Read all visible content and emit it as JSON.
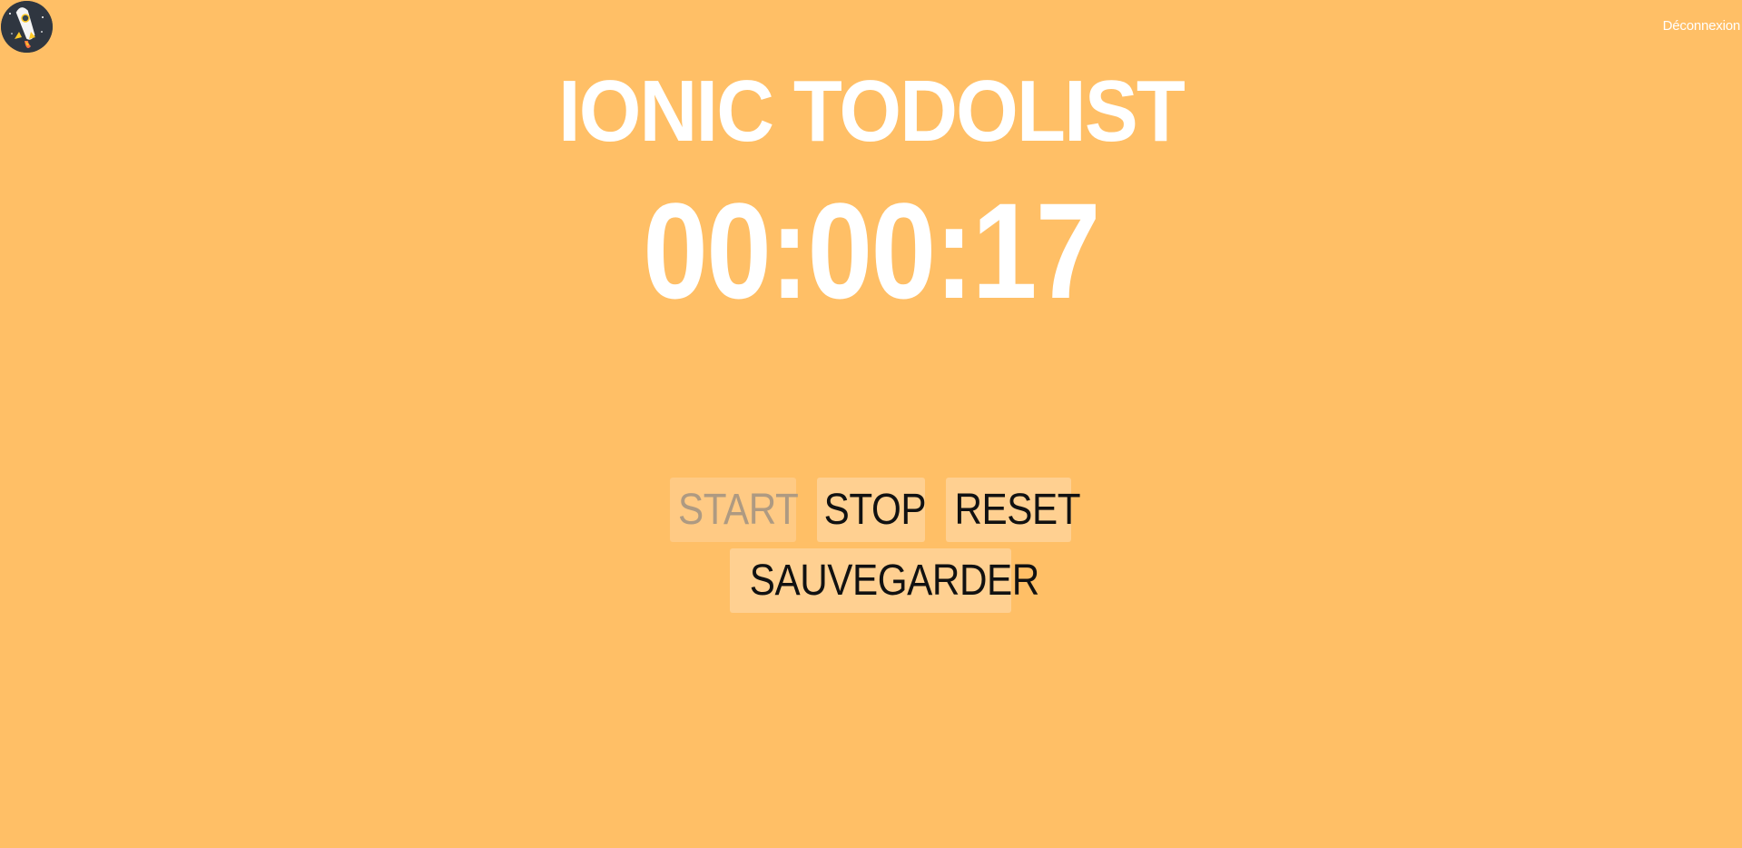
{
  "app": {
    "title": "IONIC TODOLIST",
    "logout_label": "Déconnexion",
    "logo_icon": "rocket-icon"
  },
  "timer": {
    "display": "00:00:17"
  },
  "controls": {
    "start_label": "START",
    "start_disabled": true,
    "stop_label": "STOP",
    "reset_label": "RESET",
    "save_label": "SAUVEGARDER"
  },
  "colors": {
    "background": "#FFBF66",
    "button_bg": "#FFD091",
    "disabled_text": "#AE9A82",
    "text_white": "#FFFFFF"
  }
}
